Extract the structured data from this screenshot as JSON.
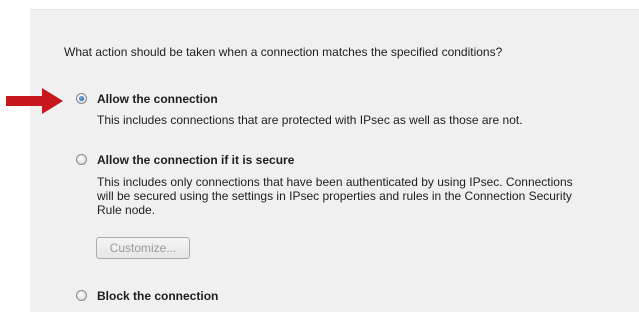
{
  "question": "What action should be taken when a connection matches the specified conditions?",
  "options": [
    {
      "label": "Allow the connection",
      "selected": true,
      "description": [
        "This includes connections that are protected with IPsec as well as those are not."
      ]
    },
    {
      "label": "Allow the connection if it is secure",
      "selected": false,
      "description": [
        "This includes only connections that have been authenticated by using IPsec.  Connections",
        "will be secured using the settings in IPsec properties and rules in the Connection Security",
        "Rule node."
      ],
      "button_label": "Customize..."
    },
    {
      "label": "Block the connection",
      "selected": false
    }
  ],
  "colors": {
    "arrow": "#c8161d",
    "radio_dot": "#2a6ab4",
    "panel_bg": "#f0f0f0",
    "disabled_text": "#9a9a9a"
  },
  "icons": {
    "pointer": "right-arrow-icon"
  }
}
